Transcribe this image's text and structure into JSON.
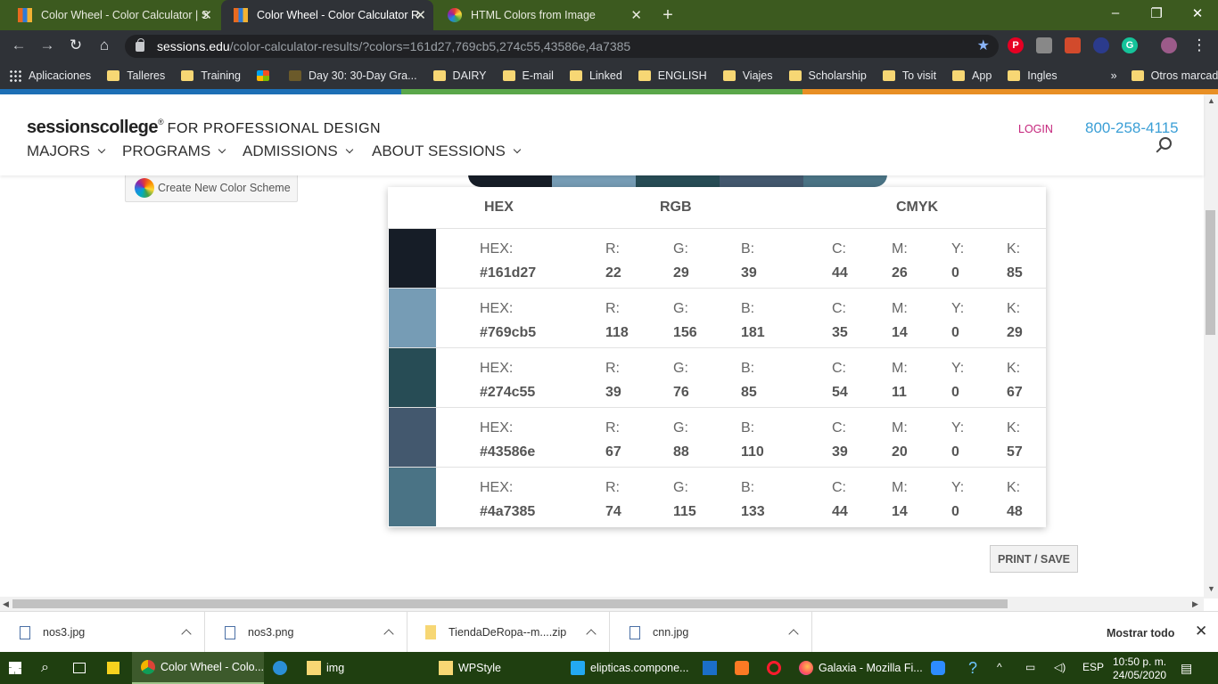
{
  "browser": {
    "tabs": [
      {
        "title": "Color Wheel - Color Calculator | S",
        "active": false
      },
      {
        "title": "Color Wheel - Color Calculator R",
        "active": true
      },
      {
        "title": "HTML Colors from Image",
        "active": false
      }
    ],
    "new_tab": "+",
    "window_controls": {
      "minimize": "–",
      "restore": "❐",
      "close": "✕"
    },
    "url_host": "sessions.edu",
    "url_path": "/color-calculator-results/?colors=161d27,769cb5,274c55,43586e,4a7385",
    "bookmarks": [
      "Aplicaciones",
      "Talleres",
      "Training",
      "Day 30: 30-Day Gra...",
      "DAIRY",
      "E-mail",
      "Linked",
      "ENGLISH",
      "Viajes",
      "Scholarship",
      "To visit",
      "App",
      "Ingles"
    ],
    "bookmarks_overflow": "»",
    "other_bookmarks": "Otros marcadores"
  },
  "site": {
    "logo_sessions": "sessions",
    "logo_college": "college",
    "logo_reg": "®",
    "logo_tagline": "FOR PROFESSIONAL DESIGN",
    "menu": [
      "MAJORS",
      "PROGRAMS",
      "ADMISSIONS",
      "ABOUT SESSIONS"
    ],
    "login": "LOGIN",
    "phone": "800-258-4115"
  },
  "content": {
    "create_button": "Create New Color Scheme",
    "headers": {
      "hex": "HEX",
      "rgb": "RGB",
      "cmyk": "CMYK"
    },
    "labels": {
      "hex": "HEX:",
      "r": "R:",
      "g": "G:",
      "b": "B:",
      "c": "C:",
      "m": "M:",
      "y": "Y:",
      "k": "K:"
    },
    "colors": [
      {
        "swatch": "#161d27",
        "hex": "#161d27",
        "r": "22",
        "g": "29",
        "b": "39",
        "c": "44",
        "m": "26",
        "y": "0",
        "k": "85"
      },
      {
        "swatch": "#769cb5",
        "hex": "#769cb5",
        "r": "118",
        "g": "156",
        "b": "181",
        "c": "35",
        "m": "14",
        "y": "0",
        "k": "29"
      },
      {
        "swatch": "#274c55",
        "hex": "#274c55",
        "r": "39",
        "g": "76",
        "b": "85",
        "c": "54",
        "m": "11",
        "y": "0",
        "k": "67"
      },
      {
        "swatch": "#43586e",
        "hex": "#43586e",
        "r": "67",
        "g": "88",
        "b": "110",
        "c": "39",
        "m": "20",
        "y": "0",
        "k": "57"
      },
      {
        "swatch": "#4a7385",
        "hex": "#4a7385",
        "r": "74",
        "g": "115",
        "b": "133",
        "c": "44",
        "m": "14",
        "y": "0",
        "k": "48"
      }
    ],
    "print_button": "PRINT / SAVE"
  },
  "downloads": {
    "items": [
      "nos3.jpg",
      "nos3.png",
      "TiendaDeRopa--m....zip",
      "cnn.jpg"
    ],
    "show_all": "Mostrar todo",
    "close": "✕"
  },
  "taskbar": {
    "apps": [
      {
        "label": "Color Wheel - Colo...",
        "active": true
      },
      {
        "label": "img",
        "active": false
      },
      {
        "label": "WPStyle",
        "active": false
      },
      {
        "label": "elipticas.compone...",
        "active": false
      },
      {
        "label": "Galaxia - Mozilla Fi...",
        "active": false
      }
    ],
    "lang": "ESP",
    "time": "10:50 p. m.",
    "date": "24/05/2020"
  }
}
